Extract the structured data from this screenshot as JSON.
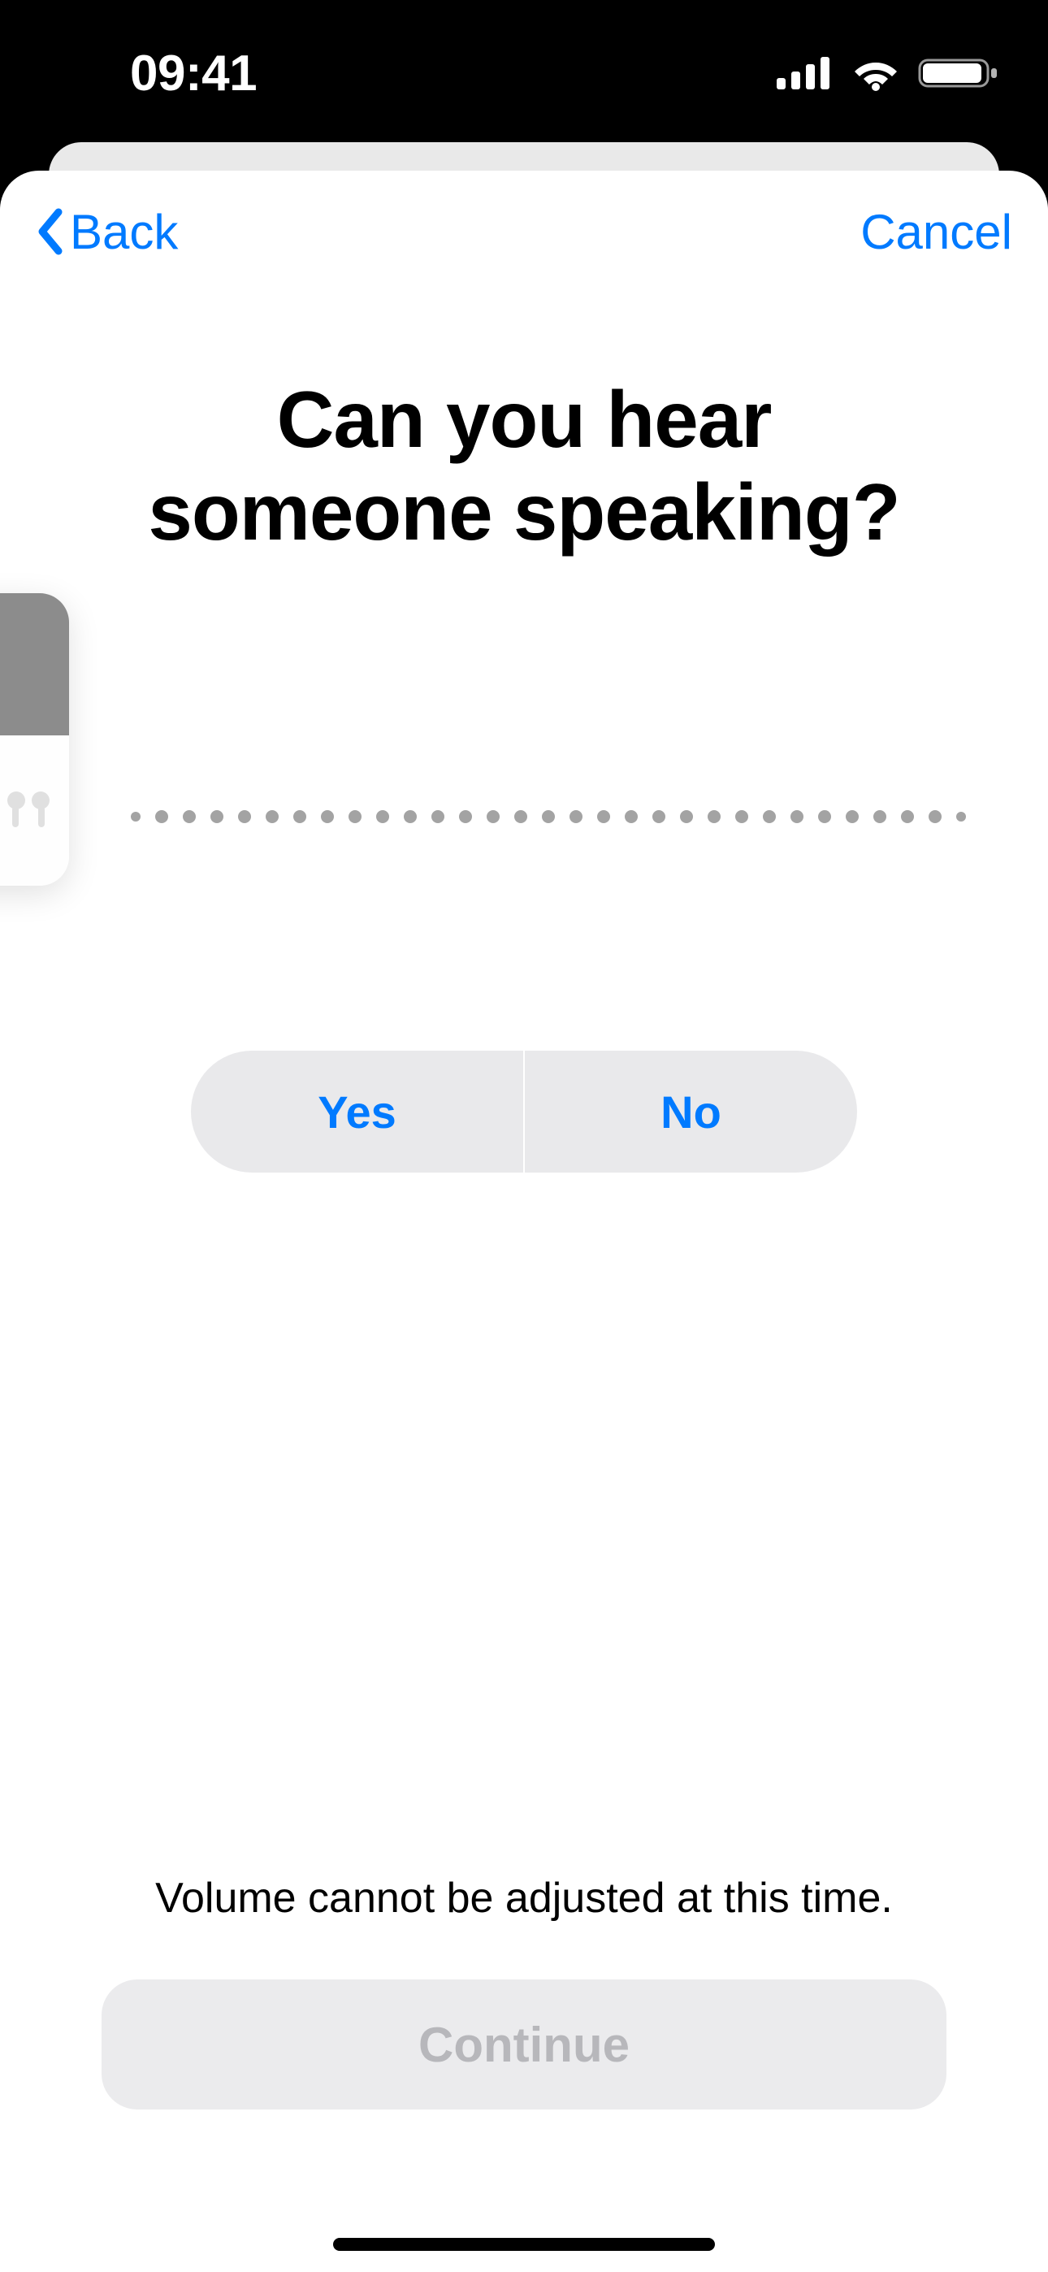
{
  "status": {
    "time": "09:41"
  },
  "nav": {
    "back_label": "Back",
    "cancel_label": "Cancel"
  },
  "heading": {
    "line1": "Can you hear",
    "line2": "someone speaking?"
  },
  "segmented": {
    "yes_label": "Yes",
    "no_label": "No"
  },
  "footer": {
    "note": "Volume cannot be adjusted at this time.",
    "continue_label": "Continue"
  }
}
